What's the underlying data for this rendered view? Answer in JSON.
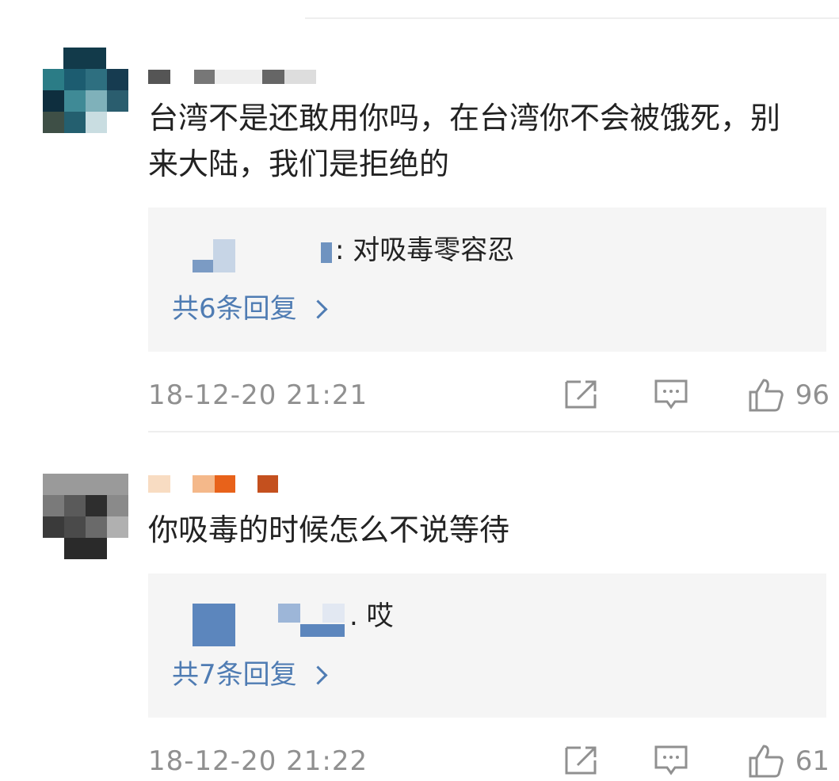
{
  "comments": [
    {
      "text": "台湾不是还敢用你吗，在台湾你不会被饿死，别来大陆，我们是拒绝的",
      "reply_preview": "对吸毒零容忍",
      "reply_count_label": "共6条回复",
      "timestamp": "18-12-20 21:21",
      "like_count": "96"
    },
    {
      "text": "你吸毒的时候怎么不说等待",
      "reply_preview": "哎",
      "reply_count_label": "共7条回复",
      "timestamp": "18-12-20 21:22",
      "like_count": "61"
    }
  ],
  "icons": {
    "share": "share-icon",
    "comment": "comment-icon",
    "like": "thumbs-up-icon"
  },
  "colors": {
    "link": "#4f7cb3",
    "meta": "#909090",
    "reply_bg": "#f5f5f5"
  }
}
